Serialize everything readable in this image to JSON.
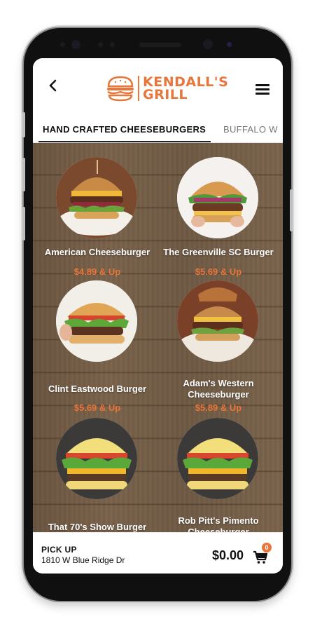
{
  "header": {
    "brand_line1": "KENDALL'S",
    "brand_line2": "GRILL",
    "brand_color": "#e8753a",
    "back_icon": "chevron-left-icon",
    "menu_icon": "hamburger-menu-icon"
  },
  "tabs": [
    {
      "label": "HAND CRAFTED CHEESEBURGERS",
      "active": true
    },
    {
      "label": "BUFFALO W",
      "active": false
    }
  ],
  "menu_items": [
    {
      "name": "American Cheeseburger",
      "price": "$4.89 & Up"
    },
    {
      "name": "The Greenville SC Burger",
      "price": "$5.69 & Up"
    },
    {
      "name": "Clint Eastwood Burger",
      "price": "$5.69 & Up"
    },
    {
      "name": "Adam's Western Cheeseburger",
      "price": "$5.89 & Up"
    },
    {
      "name": "That 70's Show Burger",
      "price": ""
    },
    {
      "name": "Rob Pitt's Pimento Cheeseburger",
      "price": ""
    }
  ],
  "footer": {
    "pickup_label": "PICK UP",
    "pickup_address": "1810 W Blue Ridge Dr",
    "total": "$0.00",
    "cart_count": "0",
    "cart_icon": "shopping-cart-icon"
  }
}
